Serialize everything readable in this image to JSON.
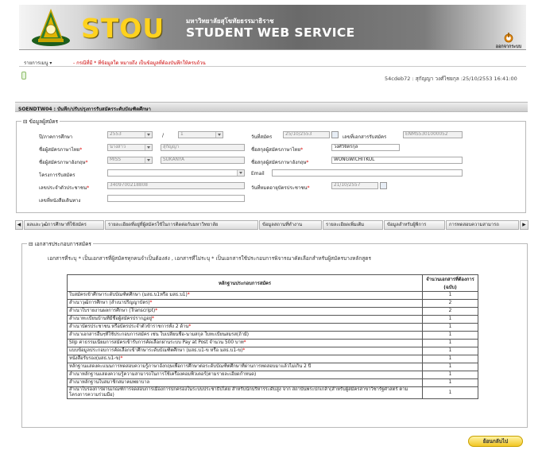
{
  "header": {
    "logo_text": "STOU",
    "university_name": "มหาวิทยาลัยสุโขทัยธรรมาธิราช",
    "service_name": "STUDENT WEB SERVICE",
    "logout_label": "ออกจากระบบ"
  },
  "menubar": {
    "menu_label": "รายการเมนู ▾",
    "note": "- กรณีที่มี * ที่ข้อมูลใด หมายถึง เป็นข้อมูลที่ต้องบันทึกให้ครบถ้วน"
  },
  "status": {
    "text": "54cdeb72 : สุกัญญา วงศ์ไชยกุล :25/10/2553 16:41:00"
  },
  "page_title": "SOENDTW04 : บันทึก/ปรับปรุงการรับสมัครระดับบัณฑิตศึกษา",
  "applicant": {
    "section_title": "ข้อมูลผู้สมัคร",
    "year_label": "ปี/ภาคการศึกษา",
    "year_value": "2553",
    "slash": "/",
    "term_value": "1",
    "apply_date_label": "วันที่สมัคร",
    "apply_date_value": "25/10/2553",
    "doc_no_label": "เลขที่เอกสารรับสมัคร",
    "doc_no_value": "ENMS5301000052",
    "prefix_th_label": "ชื่อผู้สมัครภาษาไทย",
    "prefix_th_value": "นางสาว",
    "first_th_value": "สุกัญญา",
    "last_th_label": "ชื่อสกุลผู้สมัครภาษาไทย",
    "last_th_value": "วงศ์วิจิตรกุล",
    "prefix_en_label": "ชื่อผู้สมัครภาษาอังกฤษ",
    "prefix_en_value": "MISS",
    "first_en_value": "SUKANYA",
    "last_en_label": "ชื่อสกุลผู้สมัครภาษาอังกฤษ",
    "last_en_value": "WONGWICHITKUL",
    "program_label": "โครงการรับสมัคร",
    "program_value": "",
    "email_label": "Email",
    "email_value": "",
    "id_label": "เลขประจำตัวประชาชน",
    "id_value": "3409700218808",
    "id_expire_label": "วันที่หมดอายุบัตรประชาชน",
    "id_expire_value": "21/10/2557",
    "passport_label": "เลขที่หนังสือเดินทาง",
    "passport_value": ""
  },
  "tabs": [
    "ผลและวุฒิการศึกษาที่ใช้สมัคร",
    "รายละเอียดที่อยู่ที่ผู้สมัครใช้ในการติดต่อกับมหาวิทยาลัย",
    "ข้อมูลสถานที่ทำงาน",
    "รายละเอียดเพิ่มเติม",
    "ข้อมูลสำหรับผู้พิการ",
    "การทดสอบความสามารถ"
  ],
  "documents": {
    "section_title": "เอกสารประกอบการสมัคร",
    "note": "เอกสารที่ระบุ * เป็นเอกสารที่ผู้สมัครทุกคนจำเป็นต้องส่ง , เอกสารที่ไม่ระบุ * เป็นเอกสารใช้ประกอบการพิจารณาคัดเลือกสำหรับผู้สมัครบางหลักสูตร",
    "col_doc": "หลักฐานประกอบการสมัคร",
    "col_count": "จำนวนเอกสารที่ต้องการ (ฉบับ)",
    "rows": [
      {
        "text": "ใบสมัครเข้าศึกษาระดับบัณฑิตศึกษา (มสธ.บ1หรือ มสธ.บ1)",
        "req": "*",
        "count": "1"
      },
      {
        "text": "สำเนาวุฒิการศึกษา (สำเนาปริญญาบัตร)",
        "req": "*",
        "count": "2"
      },
      {
        "text": "สำเนาใบรายงานผลการศึกษา (Transcript)",
        "req": "*",
        "count": "2"
      },
      {
        "text": "สำเนาทะเบียนบ้านที่มีชื่อผู้สมัครปรากฏอยู่",
        "req": "*",
        "count": "1"
      },
      {
        "text": "สำเนาบัตรประชาชน หรือบัตรประจำตัวข้าราชการทั้ง 2 ด้าน",
        "req": "*",
        "count": "1"
      },
      {
        "text": "สำเนาเอกสารอื่นๆที่ใช้ประกอบการสมัคร เช่น ใบเปลี่ยนชื่อ-นามสกุล ใบทะเบียนสมรส(ถ้ามี)",
        "req": "",
        "count": "1"
      },
      {
        "text": "Slip ค่าธรรมเนียมการสมัครเข้ารับการคัดเลือกผ่านระบบ Pay at Post จำนวน 500 บาท",
        "req": "*",
        "count": "1"
      },
      {
        "text": "แบบข้อมูลประกอบการคัดเลือกเข้าศึกษาระดับบัณฑิตศึกษา (มสธ.บ1-ข หรือ มสธ.บ1-ข)",
        "req": "*",
        "count": "1"
      },
      {
        "text": "หนังสือรับรอง(มสธ.บ1-ข)",
        "req": "*",
        "count": "1"
      },
      {
        "text": "หลักฐานแสดงคะแนนการทดสอบความรู้ภาษาอังกฤษเพื่อการศึกษาต่อระดับบัณฑิตศึกษาที่ผ่านการทดสอบมาแล้วไม่เกิน 2 ปี",
        "req": "",
        "count": "1"
      },
      {
        "text": "สำเนาหลักฐานแสดงความรู้ความสามารถในการใช้เครื่องคอมพิวเตอร์(ตามรายละเอียดกำหนด)",
        "req": "",
        "count": "1"
      },
      {
        "text": "สำเนาหลักฐานใบสมาชิกสมาคมพยาบาล",
        "req": "",
        "count": "1"
      },
      {
        "text": "สำเนาใบรองการผ่านเกณฑ์การจดสอบการเมืองการปกครองในระบบประชาธิปไตย สำหรับนักบริหารระดับสูง จาก สถาบันพระปกเกล้า(สำหรับผู้สมัครสาขาวิชารัฐศาสตร์ ตามโครงการความร่วมมือ)",
        "req": "",
        "count": "1"
      }
    ]
  },
  "return_button": "ย้อนกลับไป"
}
